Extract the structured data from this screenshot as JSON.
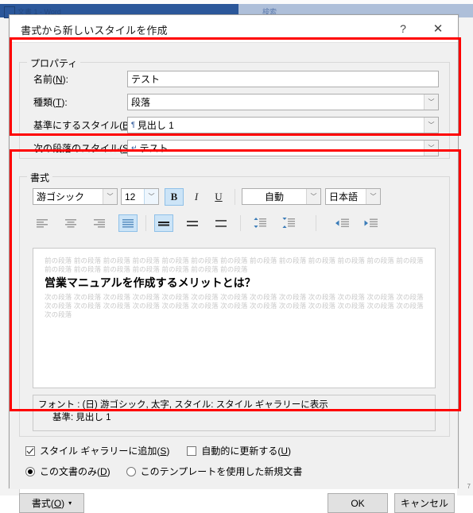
{
  "background": {
    "app_title": "文書 1 - Word",
    "search_placeholder": "検索",
    "page_number": "7"
  },
  "dialog": {
    "title": "書式から新しいスタイルを作成",
    "help_icon": "?",
    "close_icon": "✕",
    "properties": {
      "group_label": "プロパティ",
      "fields": [
        {
          "label_pre": "名前(",
          "accel": "N",
          "label_post": "):",
          "value": "テスト",
          "type": "text",
          "mark": ""
        },
        {
          "label_pre": "種類(",
          "accel": "T",
          "label_post": "):",
          "value": "段落",
          "type": "combo",
          "mark": ""
        },
        {
          "label_pre": "基準にするスタイル(",
          "accel": "B",
          "label_post": "):",
          "value": "見出し 1",
          "type": "combo",
          "mark": "¶"
        },
        {
          "label_pre": "次の段落のスタイル(",
          "accel": "S",
          "label_post": "):",
          "value": "テスト",
          "type": "combo",
          "mark": "↵"
        }
      ]
    },
    "formatting": {
      "group_label": "書式",
      "font_family": "游ゴシック",
      "font_size": "12",
      "bold_label": "B",
      "italic_label": "I",
      "underline_label": "U",
      "font_color": "自動",
      "language": "日本語",
      "bold_active": true,
      "align_selected_index": 3,
      "spacing_selected_index": 0,
      "preview": {
        "prev_paragraph": "前の段落 前の段落 前の段落 前の段落 前の段落 前の段落 前の段落 前の段落 前の段落 前の段落 前の段落 前の段落 前の段落 前の段落 前の段落 前の段落 前の段落 前の段落 前の段落 前の段落",
        "heading": "営業マニュアルを作成するメリットとは？",
        "next_paragraph": "次の段落 次の段落 次の段落 次の段落 次の段落 次の段落 次の段落 次の段落 次の段落 次の段落 次の段落 次の段落 次の段落 次の段落 次の段落 次の段落 次の段落 次の段落 次の段落 次の段落 次の段落 次の段落 次の段落 次の段落 次の段落 次の段落 次の段落"
      },
      "description_line1": "フォント : (日) 游ゴシック, 太字, スタイル: スタイル ギャラリーに表示",
      "description_line2": "基準: 見出し 1"
    },
    "options": {
      "add_to_gallery": {
        "pre": "スタイル ギャラリーに追加(",
        "accel": "S",
        "post": ")",
        "checked": true
      },
      "auto_update": {
        "pre": "自動的に更新する(",
        "accel": "U",
        "post": ")",
        "checked": false
      },
      "this_document_only": {
        "pre": "この文書のみ(",
        "accel": "D",
        "post": ")",
        "selected": true
      },
      "new_docs_from_template": {
        "pre": "このテンプレートを使用した新規文書",
        "accel": "",
        "post": "",
        "selected": false
      }
    },
    "buttons": {
      "format_pre": "書式(",
      "format_accel": "O",
      "format_post": ")",
      "format_caret": "▾",
      "ok": "OK",
      "cancel": "キャンセル"
    }
  },
  "annotations": {
    "accent_color": "#ff0000",
    "box1_name": "properties-highlight",
    "box2_name": "formatting-highlight"
  }
}
